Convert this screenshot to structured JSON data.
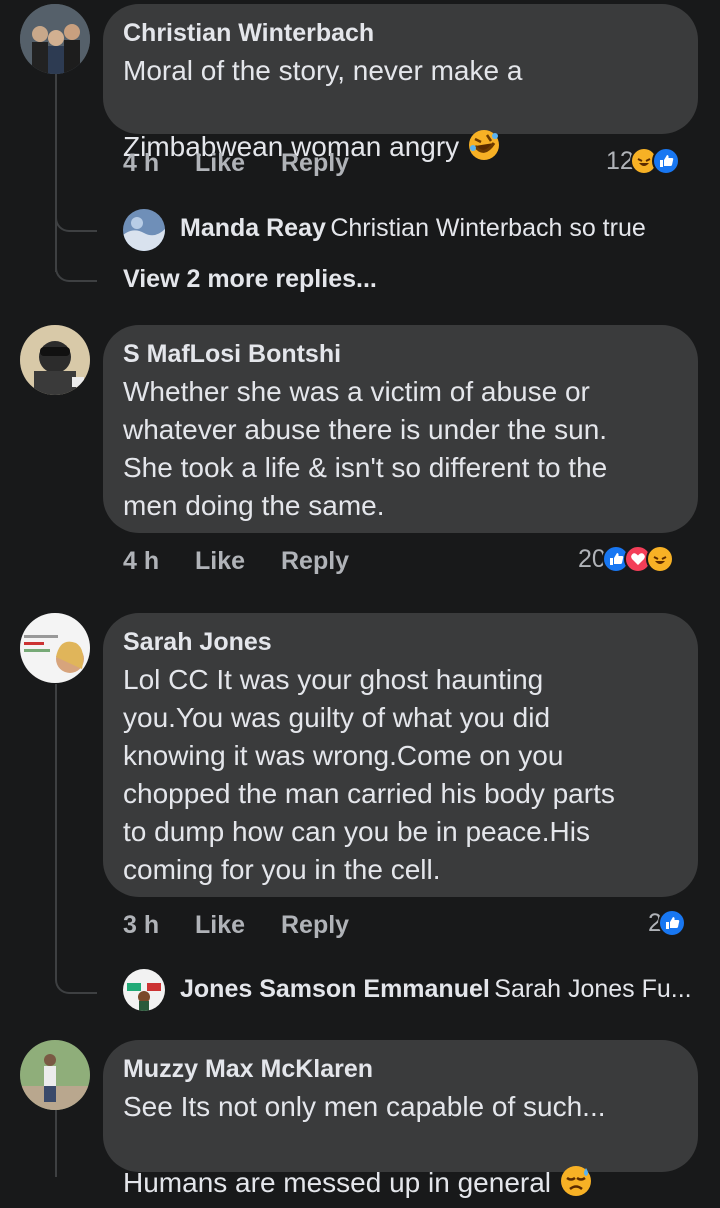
{
  "comments": [
    {
      "author": "Christian Winterbach",
      "lines": "Moral of the story, never make a\nZimbabwean woman angry",
      "emoji": "rolling-laughing-emoji",
      "time": "4 h",
      "like": "Like",
      "reply": "Reply",
      "reaction_count": "12",
      "reactions": [
        "haha",
        "like"
      ],
      "reply_preview": {
        "name": "Manda Reay",
        "text": "Christian Winterbach so true"
      },
      "more_replies": "View 2 more replies..."
    },
    {
      "author": "S MafLosi Bontshi",
      "lines": "Whether she was a victim of abuse or\nwhatever abuse there is under the sun.\nShe took a life & isn't so different to the\nmen doing the same.",
      "time": "4 h",
      "like": "Like",
      "reply": "Reply",
      "reaction_count": "20",
      "reactions": [
        "like",
        "love",
        "haha"
      ]
    },
    {
      "author": "Sarah Jones",
      "lines": "Lol CC It was your ghost haunting\nyou.You was guilty of what you did\nknowing it was wrong.Come on you\nchopped the man carried his body parts\nto dump how can you be in peace.His\ncoming for you in the cell.",
      "time": "3 h",
      "like": "Like",
      "reply": "Reply",
      "reaction_count": "2",
      "reactions": [
        "like"
      ],
      "reply_preview": {
        "name": "Jones Samson Emmanuel",
        "text": "Sarah Jones Fu..."
      }
    },
    {
      "author": "Muzzy Max McKlaren",
      "lines": "See Its not only men capable of such...\nHumans are messed up in general",
      "emoji": "sad-sweat-emoji"
    }
  ],
  "colors": {
    "background": "#18191a",
    "bubble": "#3a3b3c",
    "like_blue": "#1877f2",
    "love_red": "#f33e58",
    "haha_yellow": "#f7b125"
  }
}
